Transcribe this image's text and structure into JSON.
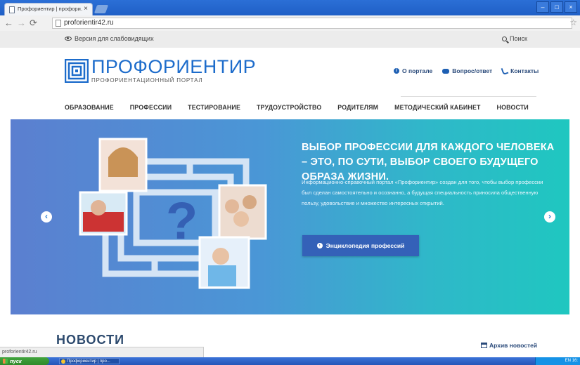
{
  "browser": {
    "tab_title": "Профориентир | профори…",
    "tab_close": "×",
    "url": "proforientir42.ru",
    "window_buttons": [
      "–",
      "□",
      "×"
    ]
  },
  "topstrip": {
    "a11y_label": "Версия для слабовидящих",
    "search_label": "Поиск"
  },
  "logo": {
    "name": "ПРОФОРИЕНТИР",
    "subtitle": "ПРОФОРИЕНТАЦИОННЫЙ ПОРТАЛ"
  },
  "topnav": [
    {
      "label": "О портале",
      "icon": "info-icon"
    },
    {
      "label": "Вопрос/ответ",
      "icon": "chat-icon"
    },
    {
      "label": "Контакты",
      "icon": "phone-icon"
    }
  ],
  "mainnav": [
    "ОБРАЗОВАНИЕ",
    "ПРОФЕССИИ",
    "ТЕСТИРОВАНИЕ",
    "ТРУДОУСТРОЙСТВО",
    "РОДИТЕЛЯМ",
    "МЕТОДИЧЕСКИЙ КАБИНЕТ",
    "НОВОСТИ"
  ],
  "hero": {
    "title": "ВЫБОР ПРОФЕССИИ ДЛЯ КАЖДОГО ЧЕЛОВЕКА – ЭТО, ПО СУТИ, ВЫБОР СВОЕГО БУДУЩЕГО ОБРАЗА ЖИЗНИ.",
    "text": "Информационно-справочный портал «Профориентир» создан для того, чтобы выбор профессии был сделан самостоятельно и осознанно, а будущая специальность приносила общественную пользу, удовольствие и множество интересных открытий.",
    "cta_label": "Энциклопедия профессий",
    "prev": "‹",
    "next": "›"
  },
  "news": {
    "title": "НОВОСТИ",
    "archive_label": "Архив новостей"
  },
  "status_bar": "proforientir42.ru",
  "taskbar": {
    "start_label": "пуск",
    "item": "Профориентир | про...",
    "clock": "EN 16:"
  },
  "colors": {
    "brand_blue": "#1d6ccb",
    "hero_start": "#5b7fd0",
    "hero_end": "#1fc7c0",
    "cta": "#3461b8"
  }
}
